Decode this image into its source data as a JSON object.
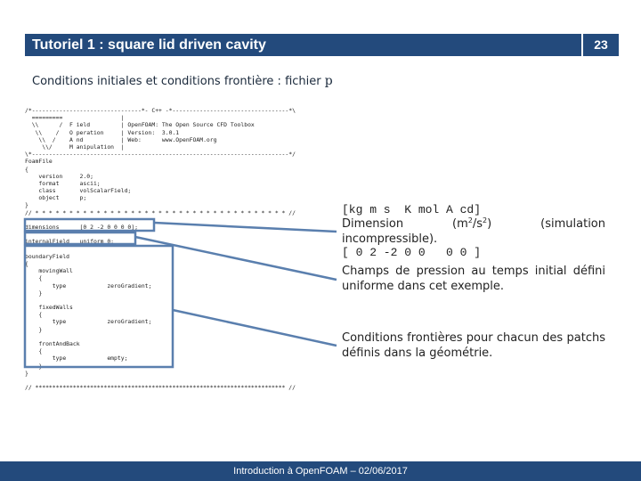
{
  "header": {
    "title": "Tutoriel 1 : square lid driven cavity",
    "page_number": "23"
  },
  "subtitle": {
    "text": "Conditions initiales et conditions frontière : fichier ",
    "file": "p"
  },
  "code": {
    "lines": [
      "/*--------------------------------*- C++ -*----------------------------------*\\",
      "  =========                 |",
      "  \\\\      /  F ield         | OpenFOAM: The Open Source CFD Toolbox",
      "   \\\\    /   O peration     | Version:  3.0.1",
      "    \\\\  /    A nd           | Web:      www.OpenFOAM.org",
      "     \\\\/     M anipulation  |",
      "\\*---------------------------------------------------------------------------*/",
      "FoamFile",
      "{",
      "    version     2.0;",
      "    format      ascii;",
      "    class       volScalarField;",
      "    object      p;",
      "}",
      "// * * * * * * * * * * * * * * * * * * * * * * * * * * * * * * * * * * * * * //",
      "",
      "dimensions      [0 2 -2 0 0 0 0];",
      "",
      "internalField   uniform 0;",
      "",
      "boundaryField",
      "{",
      "    movingWall",
      "    {",
      "        type            zeroGradient;",
      "    }",
      "",
      "    fixedWalls",
      "    {",
      "        type            zeroGradient;",
      "    }",
      "",
      "    frontAndBack",
      "    {",
      "        type            empty;",
      "    }",
      "}",
      "",
      "// ************************************************************************* //"
    ]
  },
  "units": {
    "header": "[kg m s  K mol A cd]",
    "values": "[ 0 2 -2 0 0   0 0 ]"
  },
  "notes": {
    "dimension": {
      "word1": "Dimension",
      "word2_pre": "(m",
      "sup1": "2",
      "word2_mid": "/s",
      "sup2": "2",
      "word2_post": ")",
      "word3": "(simulation",
      "line2": "incompressible)."
    },
    "internal_field": "Champs de pression au temps initial défini uniforme dans cet exemple.",
    "boundary": "Conditions frontières pour chacun des patchs définis dans la géométrie."
  },
  "footer": {
    "text": "Introduction à OpenFOAM – 02/06/2017"
  },
  "colors": {
    "brand": "#234a7c",
    "highlight": "#5a7fae"
  }
}
